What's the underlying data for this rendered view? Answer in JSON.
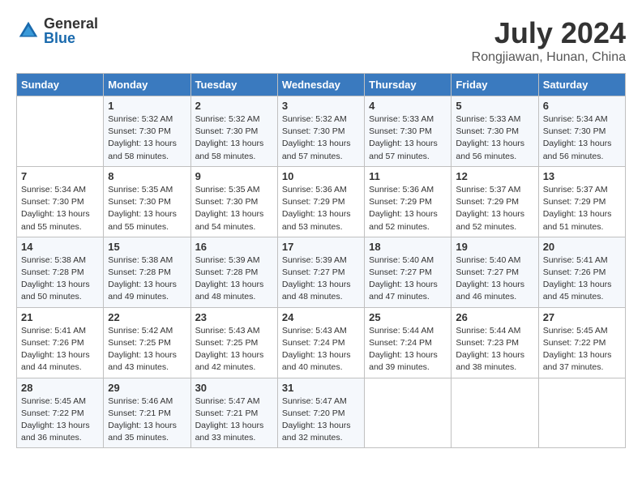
{
  "header": {
    "logo_line1": "General",
    "logo_line2": "Blue",
    "title": "July 2024",
    "location": "Rongjiawan, Hunan, China"
  },
  "days_of_week": [
    "Sunday",
    "Monday",
    "Tuesday",
    "Wednesday",
    "Thursday",
    "Friday",
    "Saturday"
  ],
  "weeks": [
    [
      {
        "day": "",
        "info": ""
      },
      {
        "day": "1",
        "info": "Sunrise: 5:32 AM\nSunset: 7:30 PM\nDaylight: 13 hours\nand 58 minutes."
      },
      {
        "day": "2",
        "info": "Sunrise: 5:32 AM\nSunset: 7:30 PM\nDaylight: 13 hours\nand 58 minutes."
      },
      {
        "day": "3",
        "info": "Sunrise: 5:32 AM\nSunset: 7:30 PM\nDaylight: 13 hours\nand 57 minutes."
      },
      {
        "day": "4",
        "info": "Sunrise: 5:33 AM\nSunset: 7:30 PM\nDaylight: 13 hours\nand 57 minutes."
      },
      {
        "day": "5",
        "info": "Sunrise: 5:33 AM\nSunset: 7:30 PM\nDaylight: 13 hours\nand 56 minutes."
      },
      {
        "day": "6",
        "info": "Sunrise: 5:34 AM\nSunset: 7:30 PM\nDaylight: 13 hours\nand 56 minutes."
      }
    ],
    [
      {
        "day": "7",
        "info": "Sunrise: 5:34 AM\nSunset: 7:30 PM\nDaylight: 13 hours\nand 55 minutes."
      },
      {
        "day": "8",
        "info": "Sunrise: 5:35 AM\nSunset: 7:30 PM\nDaylight: 13 hours\nand 55 minutes."
      },
      {
        "day": "9",
        "info": "Sunrise: 5:35 AM\nSunset: 7:30 PM\nDaylight: 13 hours\nand 54 minutes."
      },
      {
        "day": "10",
        "info": "Sunrise: 5:36 AM\nSunset: 7:29 PM\nDaylight: 13 hours\nand 53 minutes."
      },
      {
        "day": "11",
        "info": "Sunrise: 5:36 AM\nSunset: 7:29 PM\nDaylight: 13 hours\nand 52 minutes."
      },
      {
        "day": "12",
        "info": "Sunrise: 5:37 AM\nSunset: 7:29 PM\nDaylight: 13 hours\nand 52 minutes."
      },
      {
        "day": "13",
        "info": "Sunrise: 5:37 AM\nSunset: 7:29 PM\nDaylight: 13 hours\nand 51 minutes."
      }
    ],
    [
      {
        "day": "14",
        "info": "Sunrise: 5:38 AM\nSunset: 7:28 PM\nDaylight: 13 hours\nand 50 minutes."
      },
      {
        "day": "15",
        "info": "Sunrise: 5:38 AM\nSunset: 7:28 PM\nDaylight: 13 hours\nand 49 minutes."
      },
      {
        "day": "16",
        "info": "Sunrise: 5:39 AM\nSunset: 7:28 PM\nDaylight: 13 hours\nand 48 minutes."
      },
      {
        "day": "17",
        "info": "Sunrise: 5:39 AM\nSunset: 7:27 PM\nDaylight: 13 hours\nand 48 minutes."
      },
      {
        "day": "18",
        "info": "Sunrise: 5:40 AM\nSunset: 7:27 PM\nDaylight: 13 hours\nand 47 minutes."
      },
      {
        "day": "19",
        "info": "Sunrise: 5:40 AM\nSunset: 7:27 PM\nDaylight: 13 hours\nand 46 minutes."
      },
      {
        "day": "20",
        "info": "Sunrise: 5:41 AM\nSunset: 7:26 PM\nDaylight: 13 hours\nand 45 minutes."
      }
    ],
    [
      {
        "day": "21",
        "info": "Sunrise: 5:41 AM\nSunset: 7:26 PM\nDaylight: 13 hours\nand 44 minutes."
      },
      {
        "day": "22",
        "info": "Sunrise: 5:42 AM\nSunset: 7:25 PM\nDaylight: 13 hours\nand 43 minutes."
      },
      {
        "day": "23",
        "info": "Sunrise: 5:43 AM\nSunset: 7:25 PM\nDaylight: 13 hours\nand 42 minutes."
      },
      {
        "day": "24",
        "info": "Sunrise: 5:43 AM\nSunset: 7:24 PM\nDaylight: 13 hours\nand 40 minutes."
      },
      {
        "day": "25",
        "info": "Sunrise: 5:44 AM\nSunset: 7:24 PM\nDaylight: 13 hours\nand 39 minutes."
      },
      {
        "day": "26",
        "info": "Sunrise: 5:44 AM\nSunset: 7:23 PM\nDaylight: 13 hours\nand 38 minutes."
      },
      {
        "day": "27",
        "info": "Sunrise: 5:45 AM\nSunset: 7:22 PM\nDaylight: 13 hours\nand 37 minutes."
      }
    ],
    [
      {
        "day": "28",
        "info": "Sunrise: 5:45 AM\nSunset: 7:22 PM\nDaylight: 13 hours\nand 36 minutes."
      },
      {
        "day": "29",
        "info": "Sunrise: 5:46 AM\nSunset: 7:21 PM\nDaylight: 13 hours\nand 35 minutes."
      },
      {
        "day": "30",
        "info": "Sunrise: 5:47 AM\nSunset: 7:21 PM\nDaylight: 13 hours\nand 33 minutes."
      },
      {
        "day": "31",
        "info": "Sunrise: 5:47 AM\nSunset: 7:20 PM\nDaylight: 13 hours\nand 32 minutes."
      },
      {
        "day": "",
        "info": ""
      },
      {
        "day": "",
        "info": ""
      },
      {
        "day": "",
        "info": ""
      }
    ]
  ]
}
